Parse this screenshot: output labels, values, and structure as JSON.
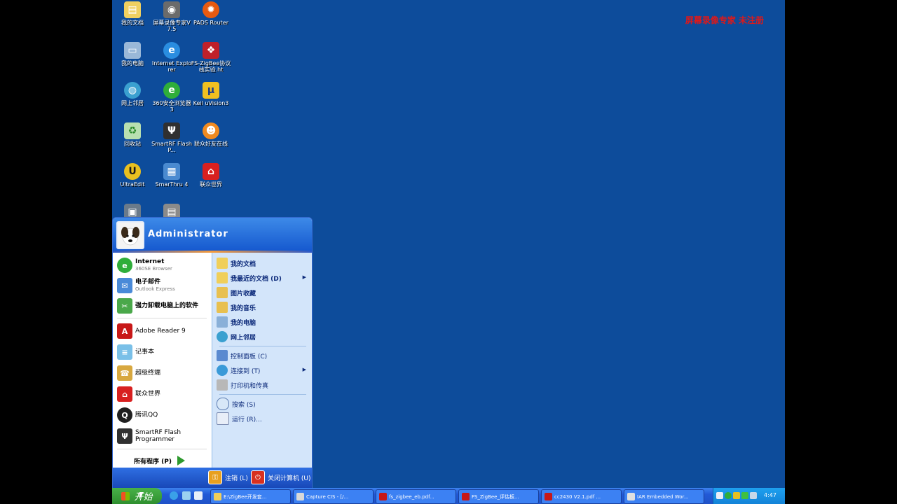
{
  "watermark": "屏幕录像专家 未注册",
  "colors": {
    "desktop": "#0d4c9b",
    "start_green": "#3a9c3a",
    "menu_blue": "#1659cf"
  },
  "desktop_icons": [
    {
      "label": "我的文档",
      "icon": "my-documents-icon"
    },
    {
      "label": "屏幕录像专家V7.5",
      "icon": "screen-recorder-icon"
    },
    {
      "label": "PADS Router",
      "icon": "pads-router-icon"
    },
    {
      "label": "我的电脑",
      "icon": "my-computer-icon"
    },
    {
      "label": "Internet Explorer",
      "icon": "ie-icon"
    },
    {
      "label": "FS-ZigBee协议栈实验.ht",
      "icon": "html-file-icon"
    },
    {
      "label": "网上邻居",
      "icon": "network-icon"
    },
    {
      "label": "360安全浏览器 3",
      "icon": "360-browser-icon"
    },
    {
      "label": "Keil uVision3",
      "icon": "keil-icon"
    },
    {
      "label": "回收站",
      "icon": "recycle-bin-icon"
    },
    {
      "label": "SmartRF Flash P...",
      "icon": "smartrf-icon"
    },
    {
      "label": "联众好友在线",
      "icon": "ourgame-friends-icon"
    },
    {
      "label": "UltraEdit",
      "icon": "ultraedit-icon"
    },
    {
      "label": "SmarThru 4",
      "icon": "smarthru-icon"
    },
    {
      "label": "联众世界",
      "icon": "ourgame-icon"
    },
    {
      "label": "",
      "icon": "unknown-app-icon"
    },
    {
      "label": "",
      "icon": "unknown-app-icon"
    }
  ],
  "start_menu": {
    "user": "Administrator",
    "pinned": [
      {
        "title": "Internet",
        "subtitle": "360SE Browser",
        "icon": "360-browser-icon"
      },
      {
        "title": "电子邮件",
        "subtitle": "Outlook Express",
        "icon": "outlook-icon"
      }
    ],
    "recent": [
      {
        "label": "强力卸载电脑上的软件",
        "icon": "uninstall-icon"
      },
      {
        "label": "Adobe Reader 9",
        "icon": "adobe-reader-icon"
      },
      {
        "label": "记事本",
        "icon": "notepad-icon"
      },
      {
        "label": "超级终端",
        "icon": "hyperterminal-icon"
      },
      {
        "label": "联众世界",
        "icon": "ourgame-icon"
      },
      {
        "label": "腾讯QQ",
        "icon": "qq-icon"
      },
      {
        "label": "SmartRF Flash Programmer",
        "icon": "smartrf-icon"
      }
    ],
    "all_programs": "所有程序 (P)",
    "right_items": [
      {
        "label": "我的文档",
        "icon": "folder-icon",
        "bold": true
      },
      {
        "label": "我最近的文档 (D)",
        "icon": "folder-icon",
        "bold": true,
        "submenu": true
      },
      {
        "label": "图片收藏",
        "icon": "pictures-icon",
        "bold": true
      },
      {
        "label": "我的音乐",
        "icon": "music-icon",
        "bold": true
      },
      {
        "label": "我的电脑",
        "icon": "my-computer-icon",
        "bold": true
      },
      {
        "label": "网上邻居",
        "icon": "network-icon",
        "bold": true
      },
      {
        "label": "控制面板 (C)",
        "icon": "control-panel-icon"
      },
      {
        "label": "连接到 (T)",
        "icon": "connect-icon",
        "submenu": true
      },
      {
        "label": "打印机和传真",
        "icon": "printer-icon"
      },
      {
        "label": "搜索 (S)",
        "icon": "search-icon"
      },
      {
        "label": "运行 (R)...",
        "icon": "run-icon"
      }
    ],
    "logoff": "注销 (L)",
    "shutdown": "关闭计算机 (U)"
  },
  "taskbar": {
    "start_label": "开始",
    "tasks": [
      {
        "label": "E:\\ZigBee开发套...",
        "icon": "folder-icon"
      },
      {
        "label": "Capture CIS - [/...",
        "icon": "capture-cis-icon"
      },
      {
        "label": "fs_zigbee_eb.pdf...",
        "icon": "pdf-icon"
      },
      {
        "label": "FS_ZigBee_评估板...",
        "icon": "pdf-icon"
      },
      {
        "label": "cc2430 V2.1.pdf ...",
        "icon": "pdf-icon"
      },
      {
        "label": "IAR Embedded Wor...",
        "icon": "iar-icon"
      }
    ],
    "clock": "4:47"
  }
}
